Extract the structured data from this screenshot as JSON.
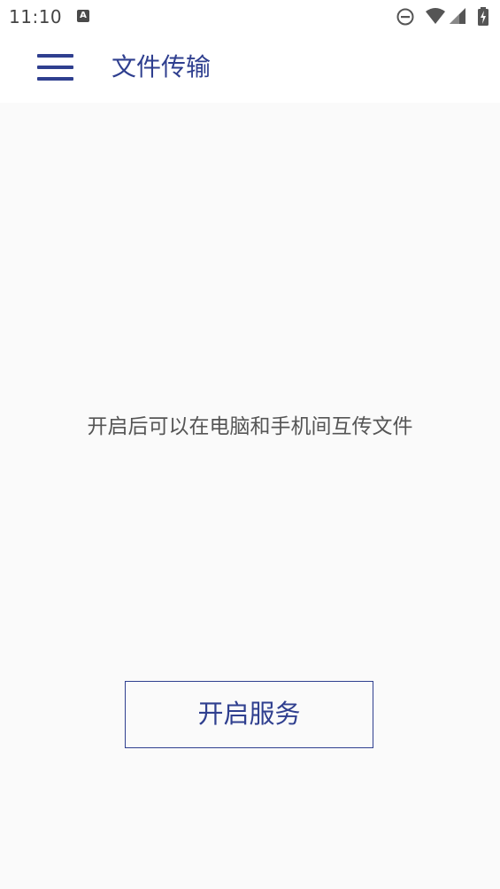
{
  "status_bar": {
    "time": "11:10",
    "notification_icon": "A",
    "icons": [
      "dnd-icon",
      "wifi-icon",
      "signal-icon",
      "battery-charging-icon"
    ]
  },
  "app_bar": {
    "menu_icon": "hamburger-menu-icon",
    "title": "文件传输"
  },
  "main": {
    "info_text": "开启后可以在电脑和手机间互传文件",
    "start_button_label": "开启服务"
  },
  "colors": {
    "accent": "#2f3f8f",
    "background": "#fafafa",
    "appbar": "#ffffff",
    "text_secondary": "#555555"
  }
}
